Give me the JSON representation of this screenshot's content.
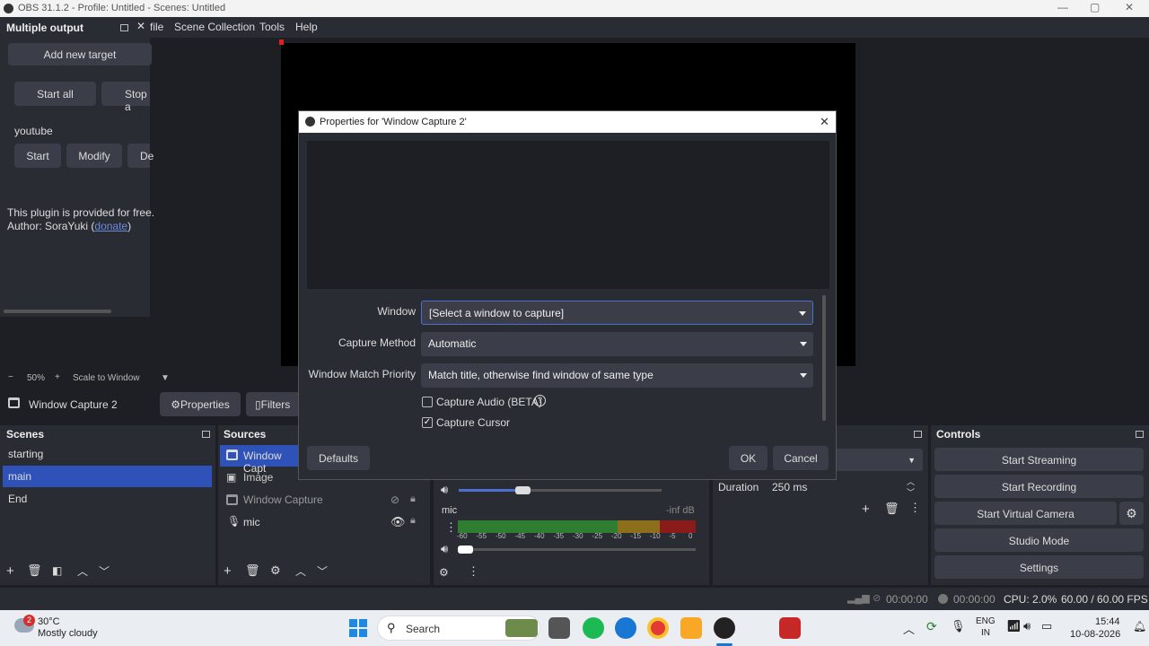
{
  "window": {
    "title": "OBS 31.1.2 - Profile: Untitled - Scenes: Untitled",
    "controls": {
      "minimize": "—",
      "maximize": "▢",
      "close": "✕"
    }
  },
  "menu": {
    "items": [
      "file",
      "Scene Collection",
      "Tools",
      "Help"
    ]
  },
  "multiple_output": {
    "title": "Multiple output",
    "add_target": "Add new target",
    "start_all": "Start all",
    "stop_all": "Stop a",
    "target_name": "youtube",
    "start": "Start",
    "modify": "Modify",
    "delete": "De",
    "info_line1": "This plugin is provided for free.",
    "info_author_prefix": "Author: SoraYuki (",
    "info_link": "donate",
    "info_author_suffix": ")"
  },
  "preview": {
    "zoom_minus": "−",
    "zoom": "50%",
    "zoom_plus": "+",
    "scale_mode": "Scale to Window"
  },
  "source_toolbar": {
    "source_name": "Window Capture 2",
    "properties": "Properties",
    "filters": "Filters"
  },
  "scenes": {
    "title": "Scenes",
    "items": [
      {
        "name": "starting",
        "selected": false
      },
      {
        "name": "main",
        "selected": true
      },
      {
        "name": "End",
        "selected": false
      }
    ]
  },
  "sources": {
    "title": "Sources",
    "items": [
      {
        "name": "Window Capt",
        "icon": "window-icon",
        "selected": true
      },
      {
        "name": "Image",
        "icon": "image-icon",
        "selected": false
      },
      {
        "name": "Window Capture",
        "icon": "window-icon",
        "selected": false
      },
      {
        "name": "mic",
        "icon": "mic-icon",
        "selected": false
      }
    ]
  },
  "audio_mixer": {
    "mic_label": "mic",
    "mic_level": "-inf dB",
    "scale": [
      "-60",
      "-55",
      "-50",
      "-45",
      "-40",
      "-35",
      "-30",
      "-25",
      "-20",
      "-15",
      "-10",
      "-5",
      "0"
    ]
  },
  "transitions": {
    "duration_label": "Duration",
    "duration_value": "250 ms"
  },
  "controls": {
    "title": "Controls",
    "start_streaming": "Start Streaming",
    "start_recording": "Start Recording",
    "start_virtual_camera": "Start Virtual Camera",
    "studio_mode": "Studio Mode",
    "settings": "Settings"
  },
  "status": {
    "stream_time": "00:00:00",
    "rec_time": "00:00:00",
    "cpu": "CPU: 2.0%",
    "fps": "60.00 / 60.00 FPS"
  },
  "dialog": {
    "title": "Properties for 'Window Capture 2'",
    "window_label": "Window",
    "window_value": "[Select a window to capture]",
    "capture_method_label": "Capture Method",
    "capture_method_value": "Automatic",
    "match_priority_label": "Window Match Priority",
    "match_priority_value": "Match title, otherwise find window of same type",
    "capture_audio": "Capture Audio (BETA)",
    "capture_audio_checked": false,
    "capture_cursor": "Capture Cursor",
    "capture_cursor_checked": true,
    "defaults": "Defaults",
    "ok": "OK",
    "cancel": "Cancel"
  },
  "taskbar": {
    "weather_temp": "30°C",
    "weather_desc": "Mostly cloudy",
    "weather_badge": "2",
    "search": "Search",
    "lang1": "ENG",
    "lang2": "IN",
    "time": "15:44",
    "date": "10-08-2026"
  },
  "colors": {
    "accent": "#2f52b8",
    "panel": "#2a2c33",
    "background": "#1e1f24",
    "button": "#3b3e48"
  }
}
